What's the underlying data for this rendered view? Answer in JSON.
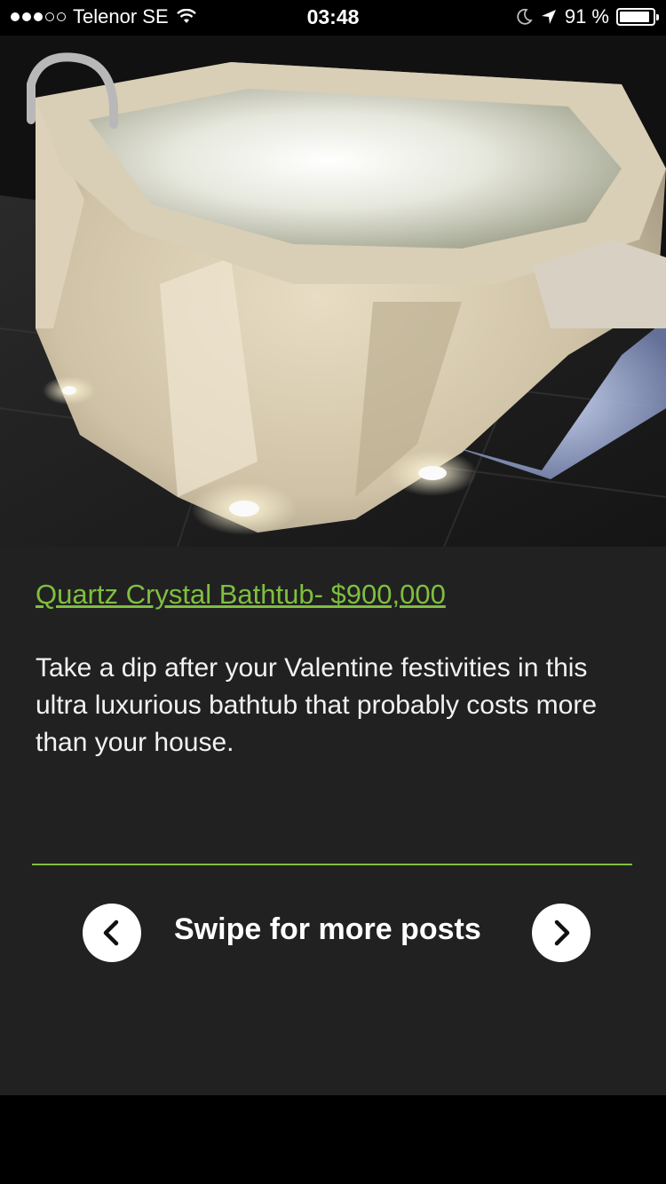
{
  "status_bar": {
    "carrier": "Telenor SE",
    "time": "03:48",
    "battery": "91 %",
    "battery_level": 0.91,
    "signal_bars_filled": 3,
    "signal_bars_total": 5
  },
  "hero": {
    "description": "Quartz crystal bathtub photo"
  },
  "post": {
    "title": "Quartz Crystal Bathtub- $900,000",
    "body": "Take a dip after your Valentine festivities in this ultra luxurious bathtub that probably costs more than your house."
  },
  "navigation": {
    "swipe_label": "Swipe for more posts"
  },
  "colors": {
    "accent": "#7fbf3f",
    "panel": "#212121"
  }
}
